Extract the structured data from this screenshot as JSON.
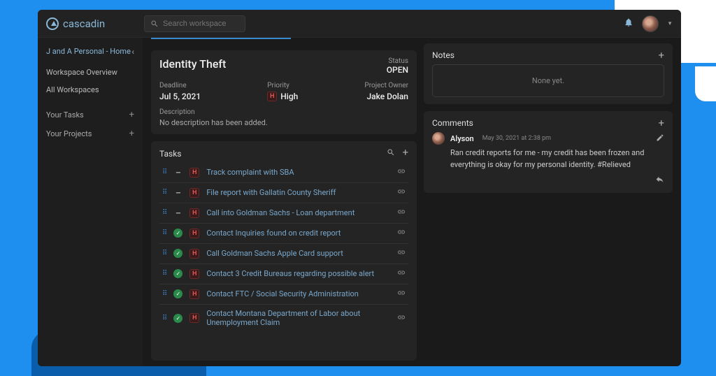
{
  "brand": "cascadin",
  "search": {
    "placeholder": "Search workspace"
  },
  "workspace": {
    "name": "J and A Personal - Home"
  },
  "sidebar": {
    "overview": "Workspace Overview",
    "all": "All Workspaces",
    "tasks": "Your Tasks",
    "projects": "Your Projects"
  },
  "project": {
    "title": "Identity Theft",
    "status_label": "Status",
    "status": "OPEN",
    "deadline_label": "Deadline",
    "deadline": "Jul 5, 2021",
    "priority_label": "Priority",
    "priority_badge": "H",
    "priority": "High",
    "owner_label": "Project Owner",
    "owner": "Jake Dolan",
    "desc_label": "Description",
    "desc": "No description has been added."
  },
  "tasks_header": "Tasks",
  "tasks": [
    {
      "done": false,
      "p": "H",
      "title": "Track complaint with SBA"
    },
    {
      "done": false,
      "p": "H",
      "title": "File report with Gallatin County Sheriff"
    },
    {
      "done": false,
      "p": "H",
      "title": "Call into Goldman Sachs - Loan department"
    },
    {
      "done": true,
      "p": "H",
      "title": "Contact Inquiries found on credit report"
    },
    {
      "done": true,
      "p": "H",
      "title": "Call Goldman Sachs Apple Card support"
    },
    {
      "done": true,
      "p": "H",
      "title": "Contact 3 Credit Bureaus regarding possible alert"
    },
    {
      "done": true,
      "p": "H",
      "title": "Contact FTC / Social Security Administration"
    },
    {
      "done": true,
      "p": "H",
      "title": "Contact Montana Department of Labor about Unemployment Claim"
    }
  ],
  "notes": {
    "header": "Notes",
    "empty": "None yet."
  },
  "comments": {
    "header": "Comments",
    "author": "Alyson",
    "timestamp": "May 30, 2021 at 2:38 pm",
    "body": "Ran credit reports for me - my credit has been frozen and everything is okay for my personal identity. #Relieved"
  }
}
